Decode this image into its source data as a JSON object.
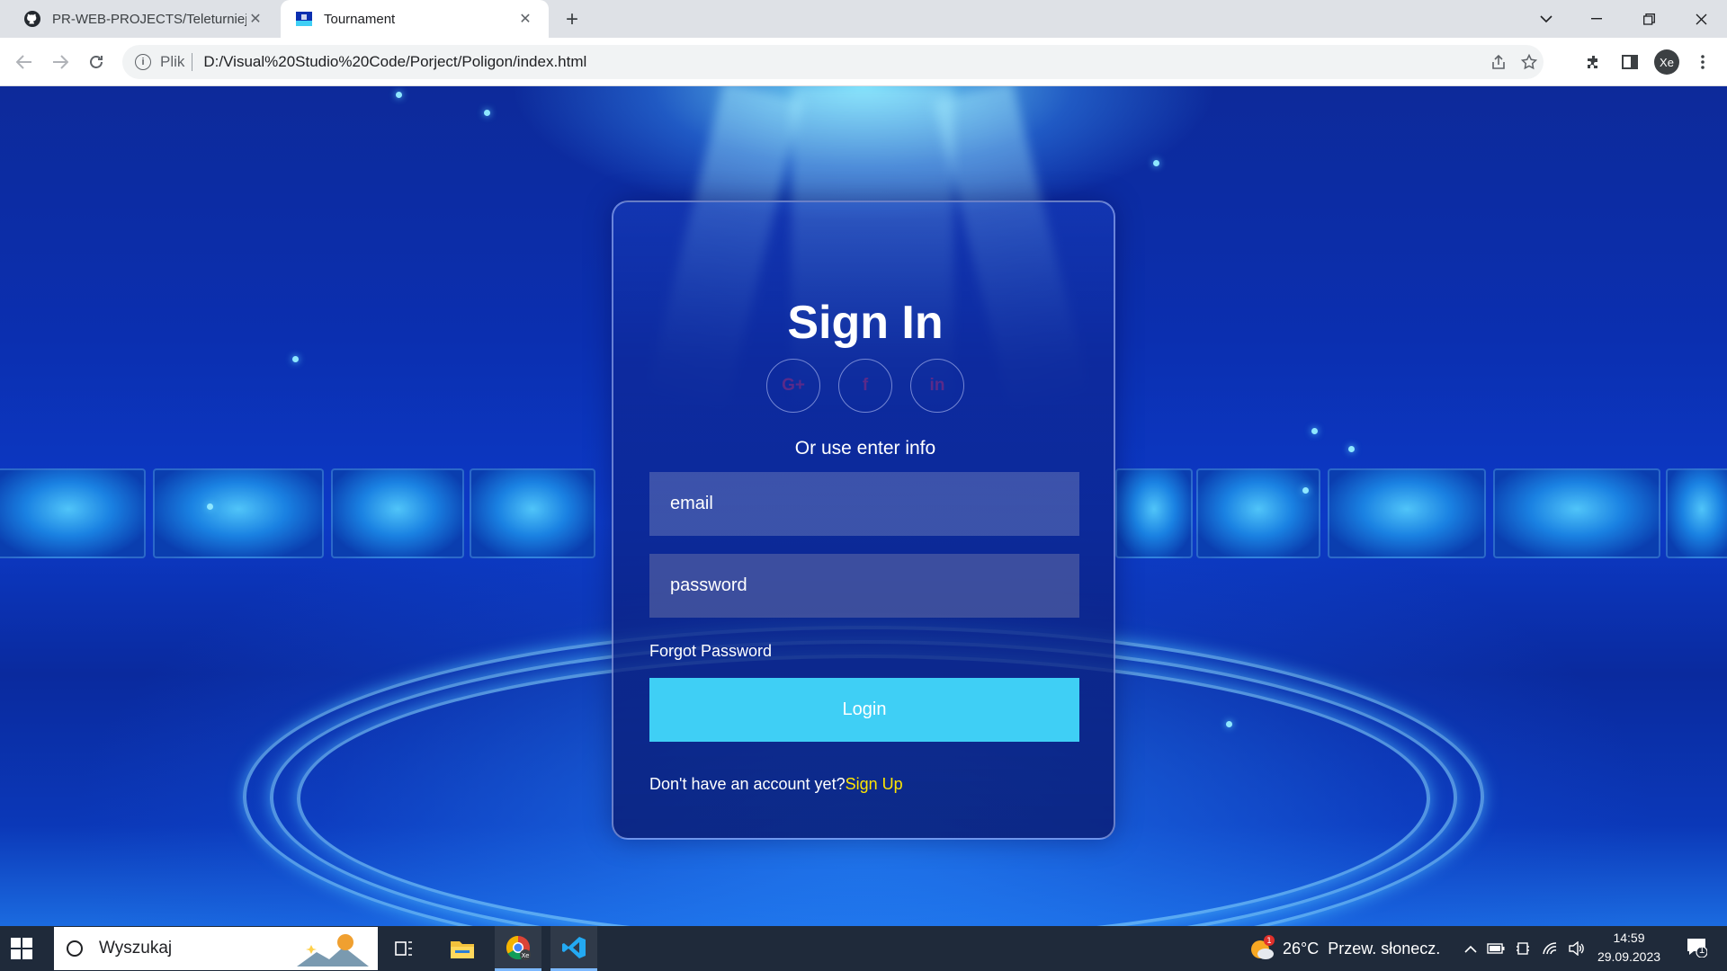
{
  "browser": {
    "tabs": [
      {
        "title": "PR-WEB-PROJECTS/Teleturniej a",
        "icon": "github-icon",
        "active": false
      },
      {
        "title": "Tournament",
        "icon": "page-favicon",
        "active": true
      }
    ],
    "new_tab_label": "+",
    "address": {
      "scheme_label": "Plik",
      "url": "D:/Visual%20Studio%20Code/Porject/Poligon/index.html"
    },
    "profile_initials": "Xe",
    "window_controls": [
      "minimize",
      "maximize",
      "close"
    ]
  },
  "signin": {
    "title": "Sign In",
    "social_buttons": [
      {
        "label": "G+",
        "icon": "google-plus-icon"
      },
      {
        "label": "f",
        "icon": "facebook-icon"
      },
      {
        "label": "in",
        "icon": "linkedin-icon"
      }
    ],
    "or_text": "Or use enter info",
    "email_placeholder": "email",
    "password_placeholder": "password",
    "forgot_label": "Forgot Password",
    "login_label": "Login",
    "no_account_text": "Don't have an account yet?",
    "signup_label": "Sign Up",
    "colors": {
      "login_button": "#3fcff5",
      "signup_link": "#ffe600",
      "title": "#ffffff"
    }
  },
  "taskbar": {
    "search_placeholder": "Wyszukaj",
    "apps": [
      "task-view-icon",
      "file-explorer-icon",
      "chrome-icon",
      "vscode-icon"
    ],
    "weather": {
      "temp": "26°C",
      "desc": "Przew. słonecz.",
      "badge": "1"
    },
    "time": "14:59",
    "date": "29.09.2023",
    "notification_count": "1"
  }
}
